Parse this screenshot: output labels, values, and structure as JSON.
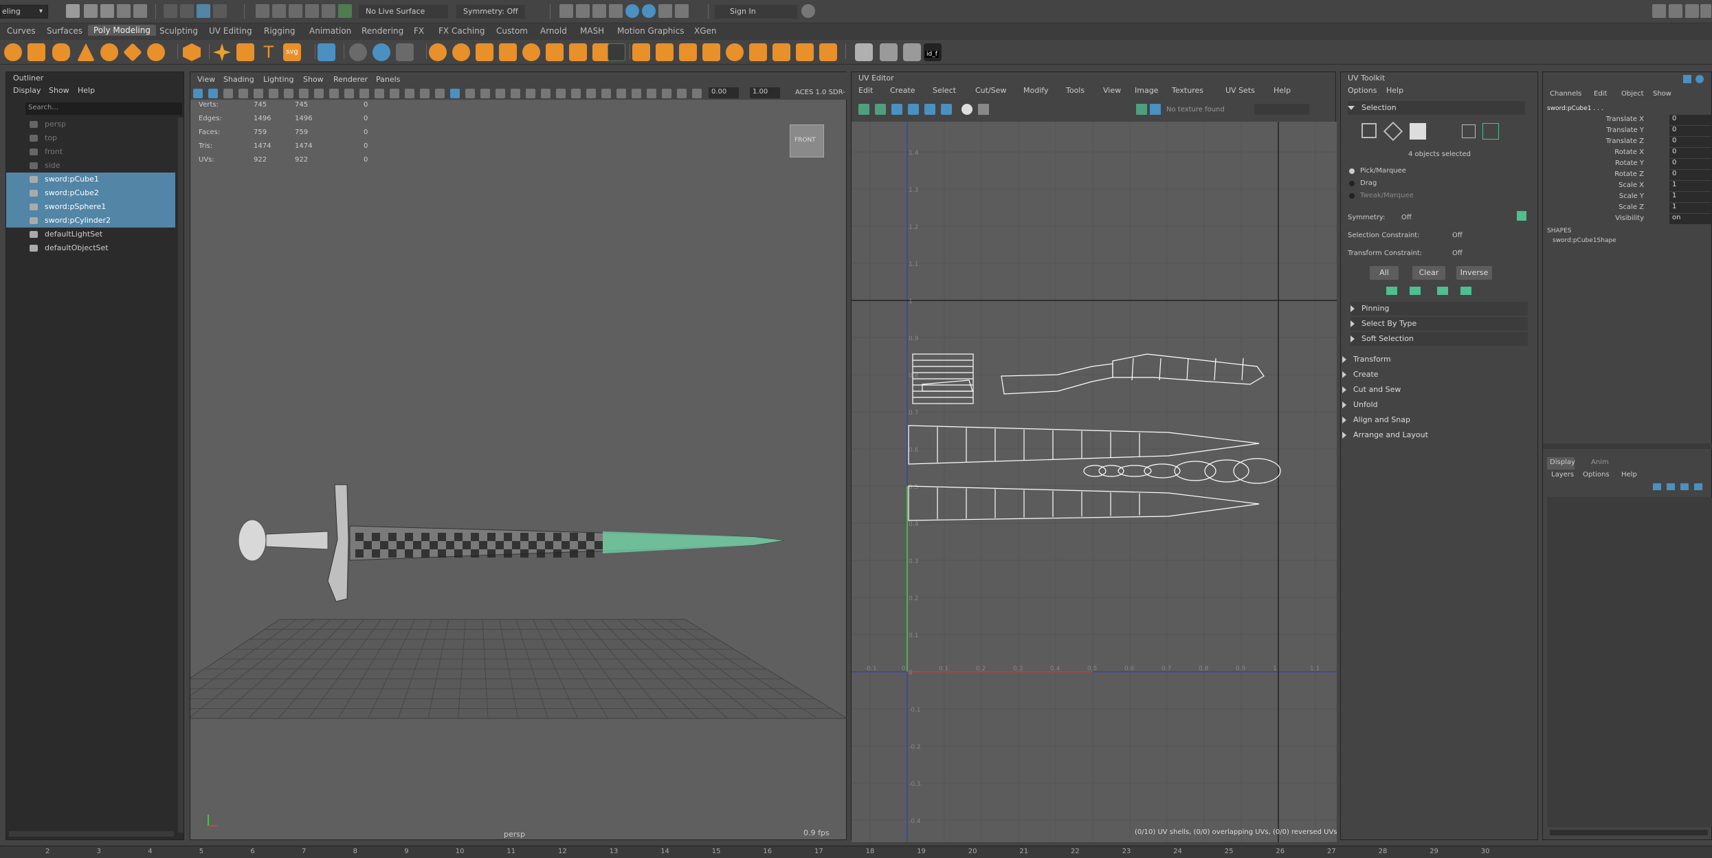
{
  "statusline": {
    "mode": "eling",
    "live_surface": "No Live Surface",
    "symmetry": "Symmetry: Off",
    "sign_in": "Sign In"
  },
  "shelf_tabs": [
    "Curves",
    "Surfaces",
    "Poly Modeling",
    "Sculpting",
    "UV Editing",
    "Rigging",
    "Animation",
    "Rendering",
    "FX",
    "FX Caching",
    "Custom",
    "Arnold",
    "MASH",
    "Motion Graphics",
    "XGen"
  ],
  "shelf_active": "Poly Modeling",
  "shelf_tooltip": "id_f",
  "outliner": {
    "title": "Outliner",
    "menu": [
      "Display",
      "Show",
      "Help"
    ],
    "search_placeholder": "Search...",
    "items": [
      {
        "label": "persp",
        "dim": true
      },
      {
        "label": "top",
        "dim": true
      },
      {
        "label": "front",
        "dim": true
      },
      {
        "label": "side",
        "dim": true
      },
      {
        "label": "sword:pCube1",
        "sel": true
      },
      {
        "label": "sword:pCube2",
        "sel": true
      },
      {
        "label": "sword:pSphere1",
        "sel": true
      },
      {
        "label": "sword:pCylinder2",
        "sel": true
      },
      {
        "label": "defaultLightSet"
      },
      {
        "label": "defaultObjectSet"
      }
    ]
  },
  "viewport": {
    "menu": [
      "View",
      "Shading",
      "Lighting",
      "Show",
      "Renderer",
      "Panels"
    ],
    "exposure": "0.00",
    "gamma": "1.00",
    "colorspace": "ACES 1.0 SDR-",
    "hud": {
      "rows": [
        [
          "Verts:",
          "745",
          "745",
          "0"
        ],
        [
          "Edges:",
          "1496",
          "1496",
          "0"
        ],
        [
          "Faces:",
          "759",
          "759",
          "0"
        ],
        [
          "Tris:",
          "1474",
          "1474",
          "0"
        ],
        [
          "UVs:",
          "922",
          "922",
          "0"
        ]
      ]
    },
    "viewcube": "FRONT",
    "camera": "persp",
    "fps": "0.9 fps"
  },
  "uv_editor": {
    "title": "UV Editor",
    "menu": [
      "Edit",
      "Create",
      "Select",
      "Cut/Sew",
      "Modify",
      "Tools",
      "View",
      "Image",
      "Textures",
      "UV Sets",
      "Help"
    ],
    "texture": "No texture found",
    "status": "(0/10) UV shells, (0/0) overlapping UVs, (0/0) reversed UVs",
    "v_ticks": [
      "1.4",
      "1.3",
      "1.2",
      "1.1",
      "1",
      "0.9",
      "0.8",
      "0.7",
      "0.6",
      "0.5",
      "0.4",
      "0.3",
      "0.2",
      "0.1",
      "0",
      "-0.1",
      "-0.2",
      "-0.3",
      "-0.4"
    ],
    "u_ticks": [
      "-0.1",
      "0",
      "0.1",
      "0.2",
      "0.3",
      "0.4",
      "0.5",
      "0.6",
      "0.7",
      "0.8",
      "0.9",
      "1",
      "1.1"
    ]
  },
  "uv_toolkit": {
    "title": "UV Toolkit",
    "menu": [
      "Options",
      "Help"
    ],
    "selection": "Selection",
    "selected_text": "4 objects selected",
    "radios": [
      "Pick/Marquee",
      "Drag",
      "Tweak/Marquee"
    ],
    "symmetry_label": "Symmetry:",
    "symmetry_val": "Off",
    "sel_constraint_label": "Selection Constraint:",
    "sel_constraint_val": "Off",
    "xf_constraint_label": "Transform Constraint:",
    "xf_constraint_val": "Off",
    "buttons": [
      "All",
      "Clear",
      "Inverse"
    ],
    "subsections": [
      "Pinning",
      "Select By Type",
      "Soft Selection"
    ],
    "sections": [
      "Transform",
      "Create",
      "Cut and Sew",
      "Unfold",
      "Align and Snap",
      "Arrange and Layout"
    ]
  },
  "channel_box": {
    "menu": [
      "Channels",
      "Edit",
      "Object",
      "Show"
    ],
    "object": "sword:pCube1 . . .",
    "attrs": [
      [
        "Translate X",
        "0"
      ],
      [
        "Translate Y",
        "0"
      ],
      [
        "Translate Z",
        "0"
      ],
      [
        "Rotate X",
        "0"
      ],
      [
        "Rotate Y",
        "0"
      ],
      [
        "Rotate Z",
        "0"
      ],
      [
        "Scale X",
        "1"
      ],
      [
        "Scale Y",
        "1"
      ],
      [
        "Scale Z",
        "1"
      ],
      [
        "Visibility",
        "on"
      ]
    ],
    "shapes_label": "SHAPES",
    "shape": "sword:pCube1Shape",
    "layer_tabs": [
      "Display",
      "Anim"
    ],
    "layer_menu": [
      "Layers",
      "Options",
      "Help"
    ]
  },
  "timeline": [
    "2",
    "3",
    "4",
    "5",
    "6",
    "7",
    "8",
    "9",
    "10",
    "11",
    "12",
    "13",
    "14",
    "15",
    "16",
    "17",
    "18",
    "19",
    "20",
    "21",
    "22",
    "23",
    "24",
    "25",
    "26",
    "27",
    "28",
    "29",
    "30"
  ]
}
